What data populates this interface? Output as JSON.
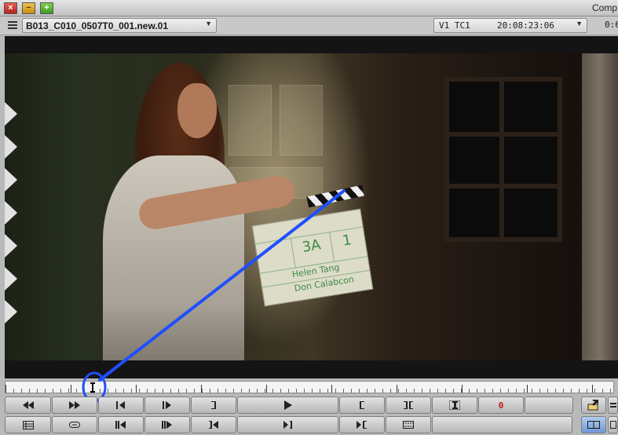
{
  "window": {
    "title": "Comp",
    "controls": {
      "close": "×",
      "minimize": "−",
      "maximize": "+"
    }
  },
  "header": {
    "clip_name": "B013_C010_0507T0_001.new.01",
    "tc_track": "V1  TC1",
    "timecode": "20:08:23:06",
    "tc_extra": "0:6"
  },
  "slate": {
    "scene": "3A",
    "take": "1",
    "line1": "Helen Tang",
    "line2": "Don Calabcon"
  },
  "playhead_position": 0.14,
  "annotation": {
    "color": "#1f4fff"
  },
  "colors": {
    "record_mark": "#c31b1b",
    "active_mode": "#6f98d6"
  },
  "transport_row1": [
    {
      "id": "rewind",
      "icon": "rewind-icon"
    },
    {
      "id": "fast-forward",
      "icon": "fast-forward-icon"
    },
    {
      "id": "step-back",
      "icon": "step-back-icon"
    },
    {
      "id": "step-forward",
      "icon": "step-forward-icon"
    },
    {
      "id": "mark-out",
      "icon": "mark-out-icon"
    },
    {
      "id": "play",
      "icon": "play-icon"
    },
    {
      "id": "mark-in",
      "icon": "mark-in-icon"
    },
    {
      "id": "mark-clip",
      "icon": "mark-clip-icon"
    },
    {
      "id": "clear-marks",
      "icon": "clear-marks-icon"
    },
    {
      "id": "record-indicator",
      "label": "0"
    },
    {
      "id": "blank",
      "icon": ""
    }
  ],
  "transport_row2": [
    {
      "id": "bin-view",
      "icon": "bin-icon"
    },
    {
      "id": "link",
      "icon": "link-icon"
    },
    {
      "id": "jog-back",
      "icon": "jog-back-icon"
    },
    {
      "id": "jog-forward",
      "icon": "jog-forward-icon"
    },
    {
      "id": "go-to-in",
      "icon": "go-to-in-icon"
    },
    {
      "id": "go-to-out",
      "icon": "go-to-out-icon"
    },
    {
      "id": "match-frame",
      "icon": "match-frame-icon"
    },
    {
      "id": "film-strip",
      "icon": "film-strip-icon"
    },
    {
      "id": "blank",
      "icon": ""
    }
  ]
}
